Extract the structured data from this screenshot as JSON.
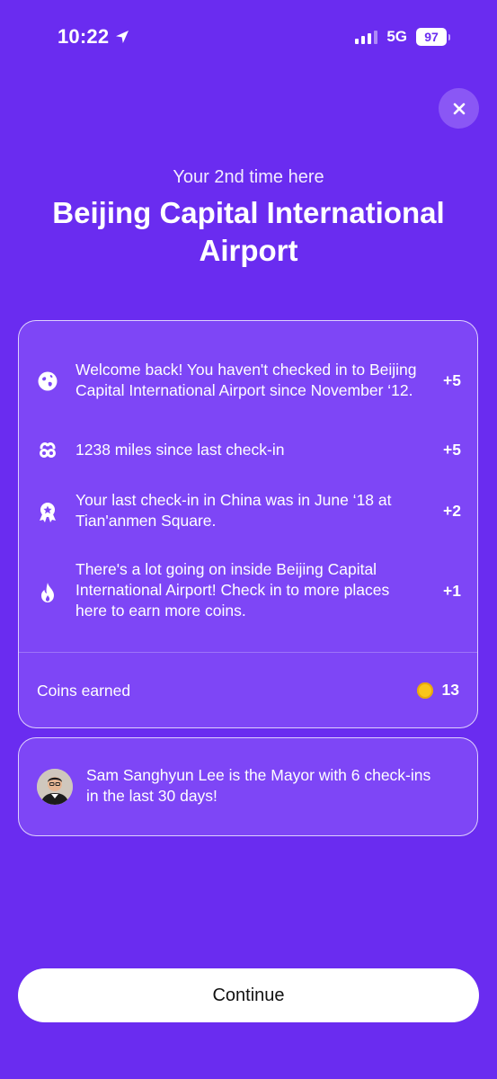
{
  "status_bar": {
    "time": "10:22",
    "network": "5G",
    "battery": "97"
  },
  "header": {
    "subtitle": "Your 2nd time here",
    "title": "Beijing Capital International Airport"
  },
  "rewards": {
    "items": [
      {
        "icon": "globe-icon",
        "text": "Welcome back! You haven't checked in to Beijing Capital International Airport since November ‘12.",
        "points": "+5"
      },
      {
        "icon": "miles-icon",
        "text": "1238 miles since last check-in",
        "points": "+5"
      },
      {
        "icon": "award-icon",
        "text": "Your last check-in in China was in June ‘18 at Tian'anmen Square.",
        "points": "+2"
      },
      {
        "icon": "flame-icon",
        "text": "There's a lot going on inside Beijing Capital International Airport! Check in to more places here to earn more coins.",
        "points": "+1"
      }
    ],
    "coins_label": "Coins earned",
    "coins_total": "13"
  },
  "mayor": {
    "text": "Sam Sanghyun Lee is the Mayor with 6 check-ins in the last 30 days!"
  },
  "continue_label": "Continue",
  "colors": {
    "background": "#6A2CF0",
    "card": "#7E46F6",
    "coin": "#F9C51C"
  }
}
